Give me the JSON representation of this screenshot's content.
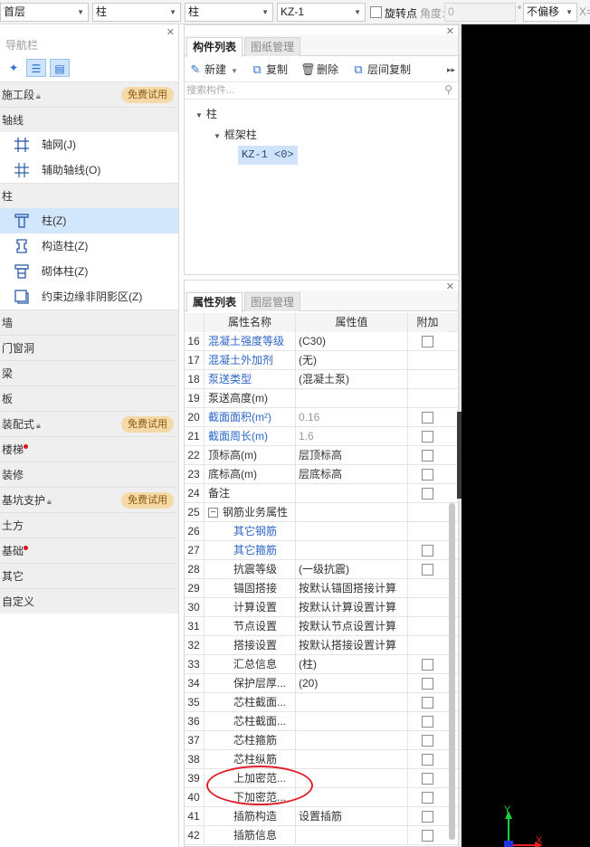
{
  "toolbar": {
    "floor": "首层",
    "type": "柱",
    "subtype": "柱",
    "component": "KZ-1",
    "rotate_label": "旋转点",
    "angle_label": "角度:",
    "angle_value": "0",
    "degree_symbol": "°",
    "offset": "不偏移",
    "x_label": "X="
  },
  "nav": {
    "title": "导航栏",
    "categories": [
      {
        "label": "施工段",
        "badge": "免费试用"
      },
      {
        "label": "轴线",
        "items": [
          "轴网(J)",
          "辅助轴线(O)"
        ]
      },
      {
        "label": "柱",
        "items": [
          "柱(Z)",
          "构造柱(Z)",
          "砌体柱(Z)",
          "约束边缘非阴影区(Z)"
        ],
        "selected": "柱(Z)"
      },
      {
        "label": "墙"
      },
      {
        "label": "门窗洞"
      },
      {
        "label": "梁"
      },
      {
        "label": "板"
      },
      {
        "label": "装配式",
        "badge": "免费试用"
      },
      {
        "label": "楼梯",
        "dot": true
      },
      {
        "label": "装修"
      },
      {
        "label": "基坑支护",
        "badge": "免费试用"
      },
      {
        "label": "土方"
      },
      {
        "label": "基础",
        "dot": true
      },
      {
        "label": "其它"
      },
      {
        "label": "自定义"
      }
    ]
  },
  "components": {
    "tabs": [
      "构件列表",
      "图纸管理"
    ],
    "actions": [
      "新建",
      "复制",
      "删除",
      "层间复制"
    ],
    "search_placeholder": "搜索构件...",
    "tree_root": "柱",
    "tree_child": "框架柱",
    "tree_leaf": "KZ-1 <0>"
  },
  "properties": {
    "tabs": [
      "属性列表",
      "图层管理"
    ],
    "headers": [
      "属性名称",
      "属性值",
      "附加"
    ],
    "rows": [
      {
        "num": "16",
        "name": "混凝土强度等级",
        "value": "(C30)",
        "style": "blue",
        "cb": true
      },
      {
        "num": "17",
        "name": "混凝土外加剂",
        "value": "(无)",
        "style": "blue",
        "cb": false
      },
      {
        "num": "18",
        "name": "泵送类型",
        "value": "(混凝土泵)",
        "style": "blue",
        "cb": false
      },
      {
        "num": "19",
        "name": "泵送高度(m)",
        "value": "",
        "style": "",
        "cb": false
      },
      {
        "num": "20",
        "name": "截面面积(m²)",
        "value": "0.16",
        "style": "blue",
        "cb": true,
        "grey_val": true
      },
      {
        "num": "21",
        "name": "截面周长(m)",
        "value": "1.6",
        "style": "blue",
        "cb": true,
        "grey_val": true
      },
      {
        "num": "22",
        "name": "顶标高(m)",
        "value": "层顶标高",
        "style": "",
        "cb": true
      },
      {
        "num": "23",
        "name": "底标高(m)",
        "value": "层底标高",
        "style": "",
        "cb": true
      },
      {
        "num": "24",
        "name": "备注",
        "value": "",
        "style": "",
        "cb": true
      },
      {
        "num": "25",
        "name": "钢筋业务属性",
        "value": "",
        "style": "group",
        "cb": false
      },
      {
        "num": "26",
        "name": "其它钢筋",
        "value": "",
        "style": "blue indent",
        "cb": false
      },
      {
        "num": "27",
        "name": "其它箍筋",
        "value": "",
        "style": "blue indent",
        "cb": true
      },
      {
        "num": "28",
        "name": "抗震等级",
        "value": "(一级抗震)",
        "style": "indent",
        "cb": true
      },
      {
        "num": "29",
        "name": "锚固搭接",
        "value": "按默认锚固搭接计算",
        "style": "indent",
        "cb": false
      },
      {
        "num": "30",
        "name": "计算设置",
        "value": "按默认计算设置计算",
        "style": "indent",
        "cb": false
      },
      {
        "num": "31",
        "name": "节点设置",
        "value": "按默认节点设置计算",
        "style": "indent",
        "cb": false
      },
      {
        "num": "32",
        "name": "搭接设置",
        "value": "按默认搭接设置计算",
        "style": "indent",
        "cb": false
      },
      {
        "num": "33",
        "name": "汇总信息",
        "value": "(柱)",
        "style": "indent",
        "cb": true
      },
      {
        "num": "34",
        "name": "保护层厚...",
        "value": "(20)",
        "style": "indent",
        "cb": true
      },
      {
        "num": "35",
        "name": "芯柱截面...",
        "value": "",
        "style": "indent",
        "cb": true
      },
      {
        "num": "36",
        "name": "芯柱截面...",
        "value": "",
        "style": "indent",
        "cb": true
      },
      {
        "num": "37",
        "name": "芯柱箍筋",
        "value": "",
        "style": "indent",
        "cb": true
      },
      {
        "num": "38",
        "name": "芯柱纵筋",
        "value": "",
        "style": "indent",
        "cb": true
      },
      {
        "num": "39",
        "name": "上加密范...",
        "value": "",
        "style": "indent",
        "cb": true
      },
      {
        "num": "40",
        "name": "下加密范...",
        "value": "",
        "style": "indent",
        "cb": true
      },
      {
        "num": "41",
        "name": "插筋构造",
        "value": "设置插筋",
        "style": "indent",
        "cb": true
      },
      {
        "num": "42",
        "name": "插筋信息",
        "value": "",
        "style": "indent",
        "cb": true
      }
    ]
  },
  "canvas": {
    "axis_y": "Y",
    "axis_x": "X"
  },
  "colors": {
    "accent": "#2e67c9",
    "badge_bg": "#f5d9a6",
    "selection": "#d2e6fc",
    "annotation": "#e0202a"
  }
}
